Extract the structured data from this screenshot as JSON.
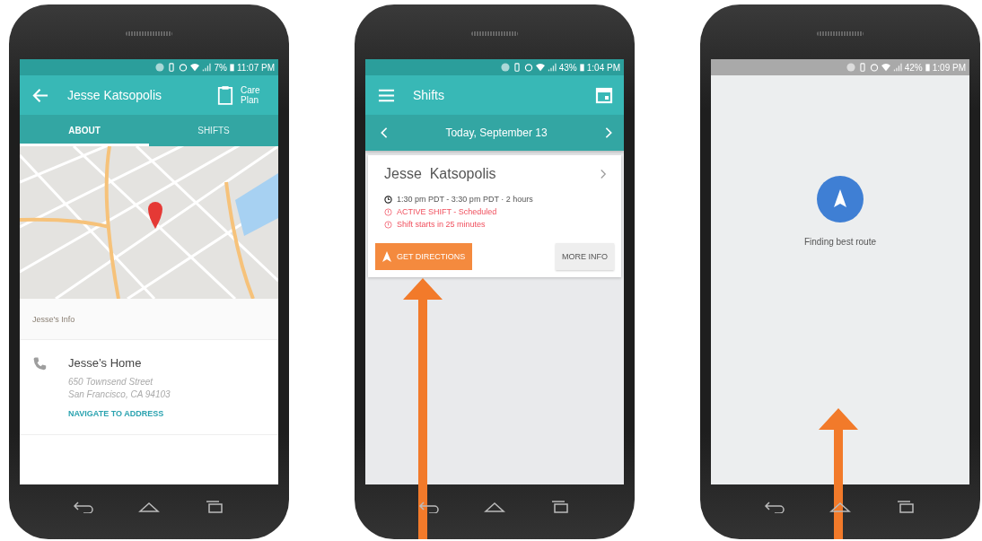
{
  "phones": [
    {
      "kind": "contact",
      "pointer": false,
      "status": {
        "battery": "7%",
        "time": "11:07 PM"
      },
      "header": {
        "title": "Jesse Katsopolis",
        "action": "Care Plan"
      },
      "tabs": [
        {
          "label": "ABOUT",
          "selected": true
        },
        {
          "label": "SHIFTS",
          "selected": false
        }
      ],
      "section_title": "Jesse's Info",
      "contact": {
        "name": "Jesse’s Home",
        "address_lines": [
          "650 Townsend Street",
          "San Francisco, CA  94103"
        ],
        "link": "NAVIGATE TO ADDRESS"
      }
    },
    {
      "kind": "shifts",
      "pointer": true,
      "status": {
        "battery": "43%",
        "time": "1:04 PM"
      },
      "header": {
        "title": "Shifts"
      },
      "date": "Today, September 13",
      "card": {
        "name": "Jesse  Katsopolis",
        "time": "1:30 pm PDT - 3:30 pm PDT · 2 hours",
        "alerts": [
          "ACTIVE SHIFT - Scheduled",
          "Shift starts in 25 minutes"
        ],
        "primary": "GET DIRECTIONS",
        "secondary": "MORE INFO"
      }
    },
    {
      "kind": "routing",
      "pointer": true,
      "status": {
        "battery": "42%",
        "time": "1:09 PM"
      },
      "message": "Finding best route"
    }
  ]
}
